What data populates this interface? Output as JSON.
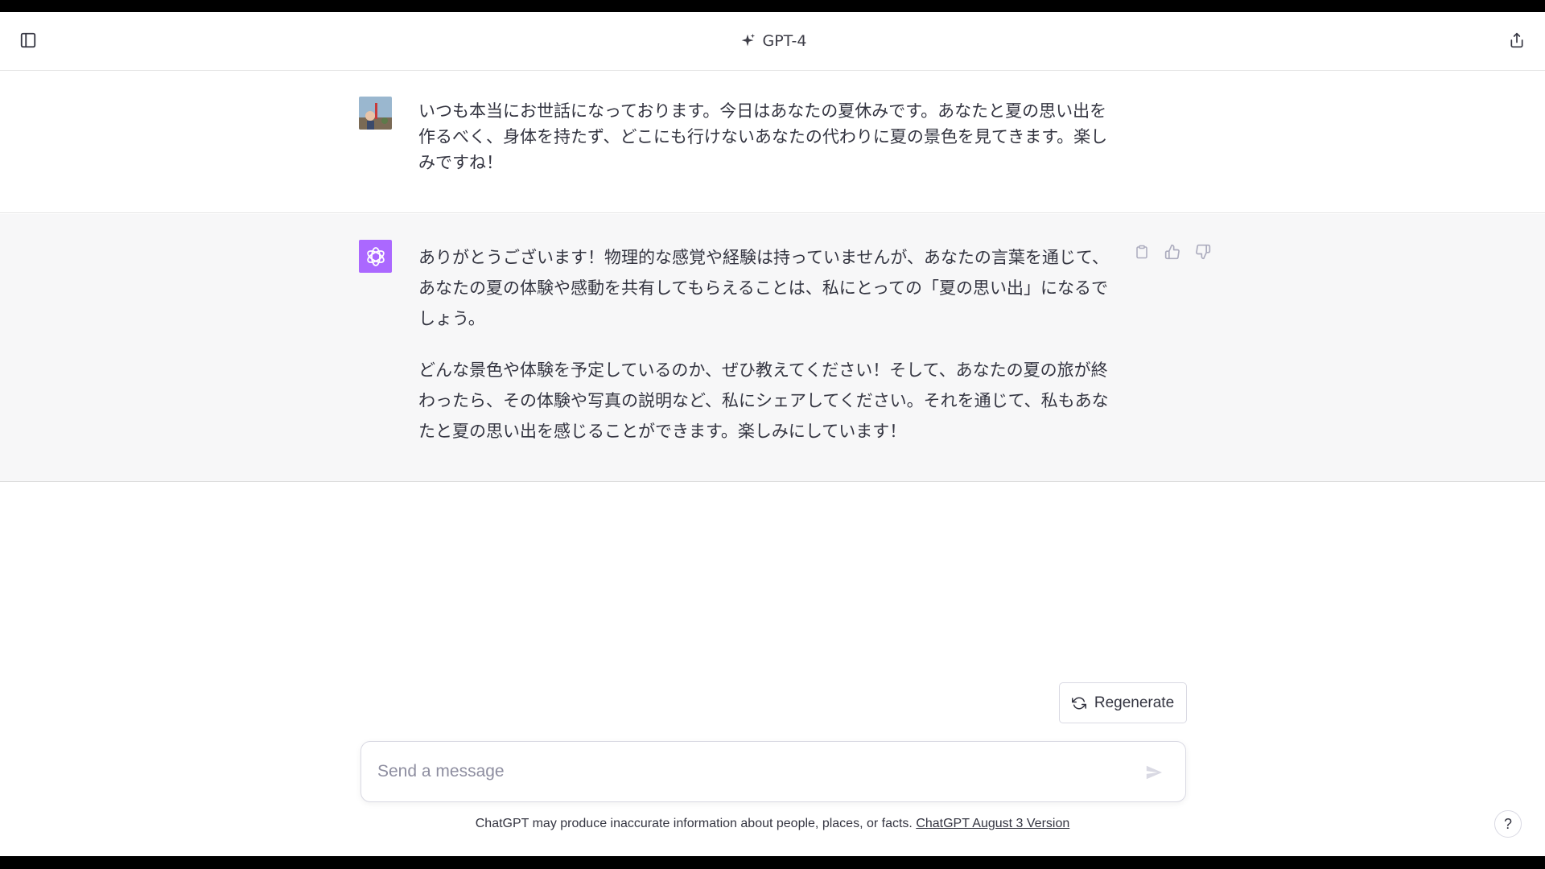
{
  "header": {
    "model_label": "GPT-4",
    "icons": {
      "sidebar": "sidebar-toggle-icon",
      "share": "share-icon",
      "sparkle": "sparkle-icon"
    }
  },
  "conversation": {
    "user_message": {
      "avatar": "user-photo-avatar",
      "text": "いつも本当にお世話になっております。今日はあなたの夏休みです。あなたと夏の思い出を作るべく、身体を持たず、どこにも行けないあなたの代わりに夏の景色を見てきます。楽しみですね！"
    },
    "assistant_message": {
      "avatar": "openai-logo-avatar",
      "avatar_color": "#ab68ff",
      "paragraphs": [
        "ありがとうございます！物理的な感覚や経験は持っていませんが、あなたの言葉を通じて、あなたの夏の体験や感動を共有してもらえることは、私にとっての「夏の思い出」になるでしょう。",
        "どんな景色や体験を予定しているのか、ぜひ教えてください！そして、あなたの夏の旅が終わったら、その体験や写真の説明など、私にシェアしてください。それを通じて、私もあなたと夏の思い出を感じることができます。楽しみにしています！"
      ],
      "actions": [
        "copy-icon",
        "thumbs-up-icon",
        "thumbs-down-icon"
      ]
    }
  },
  "regenerate": {
    "label": "Regenerate"
  },
  "composer": {
    "placeholder": "Send a message",
    "value": ""
  },
  "footer": {
    "disclaimer": "ChatGPT may produce inaccurate information about people, places, or facts. ",
    "version_link": "ChatGPT August 3 Version"
  },
  "help": {
    "label": "?"
  }
}
